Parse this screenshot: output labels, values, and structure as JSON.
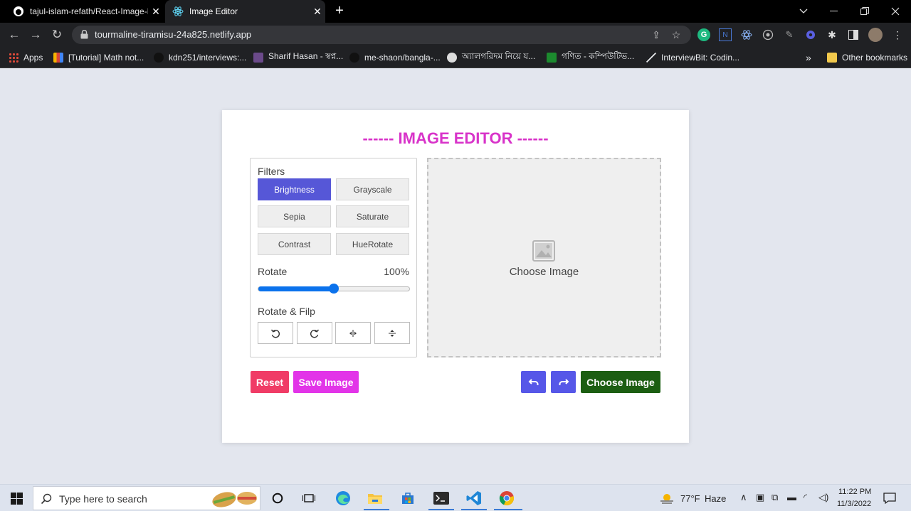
{
  "browser": {
    "tabs": [
      {
        "title": "tajul-islam-refath/React-Image-E",
        "close": "✕"
      },
      {
        "title": "Image Editor",
        "close": "✕"
      }
    ],
    "new_tab": "+",
    "url": "tourmaline-tiramisu-24a825.netlify.app",
    "bookmarks": [
      {
        "label": "Apps"
      },
      {
        "label": "[Tutorial] Math not..."
      },
      {
        "label": "kdn251/interviews:..."
      },
      {
        "label": "Sharif Hasan - স্বপ্ন..."
      },
      {
        "label": "me-shaon/bangla-..."
      },
      {
        "label": "অ্যালগরিদম নিয়ে য..."
      },
      {
        "label": "গণিত - কম্পিউটিভ..."
      },
      {
        "label": "InterviewBit: Codin..."
      }
    ],
    "bookmarks_more": "»",
    "other_bookmarks": "Other bookmarks",
    "extension_g": "G",
    "extension_n": "N"
  },
  "app": {
    "title": "------ IMAGE EDITOR ------",
    "filters_label": "Filters",
    "filters": [
      {
        "label": "Brightness",
        "active": true
      },
      {
        "label": "Grayscale",
        "active": false
      },
      {
        "label": "Sepia",
        "active": false
      },
      {
        "label": "Saturate",
        "active": false
      },
      {
        "label": "Contrast",
        "active": false
      },
      {
        "label": "HueRotate",
        "active": false
      }
    ],
    "rotate_label": "Rotate",
    "rotate_value": "100%",
    "slider_fraction": 0.5,
    "rotate_flip_label": "Rotate & Filp",
    "dropzone_label": "Choose Image",
    "buttons": {
      "reset": "Reset",
      "save": "Save Image",
      "choose": "Choose Image"
    },
    "colors": {
      "title": "#d833c9",
      "active_filter": "#5657d7",
      "reset": "#f03c66",
      "save": "#e234e8",
      "undo_redo": "#5657e8",
      "choose": "#1c5e12",
      "slider": "#0b72ec"
    }
  },
  "taskbar": {
    "search_placeholder": "Type here to search",
    "weather_temp": "77°F",
    "weather_text": "Haze",
    "time": "11:22 PM",
    "date": "11/3/2022"
  }
}
